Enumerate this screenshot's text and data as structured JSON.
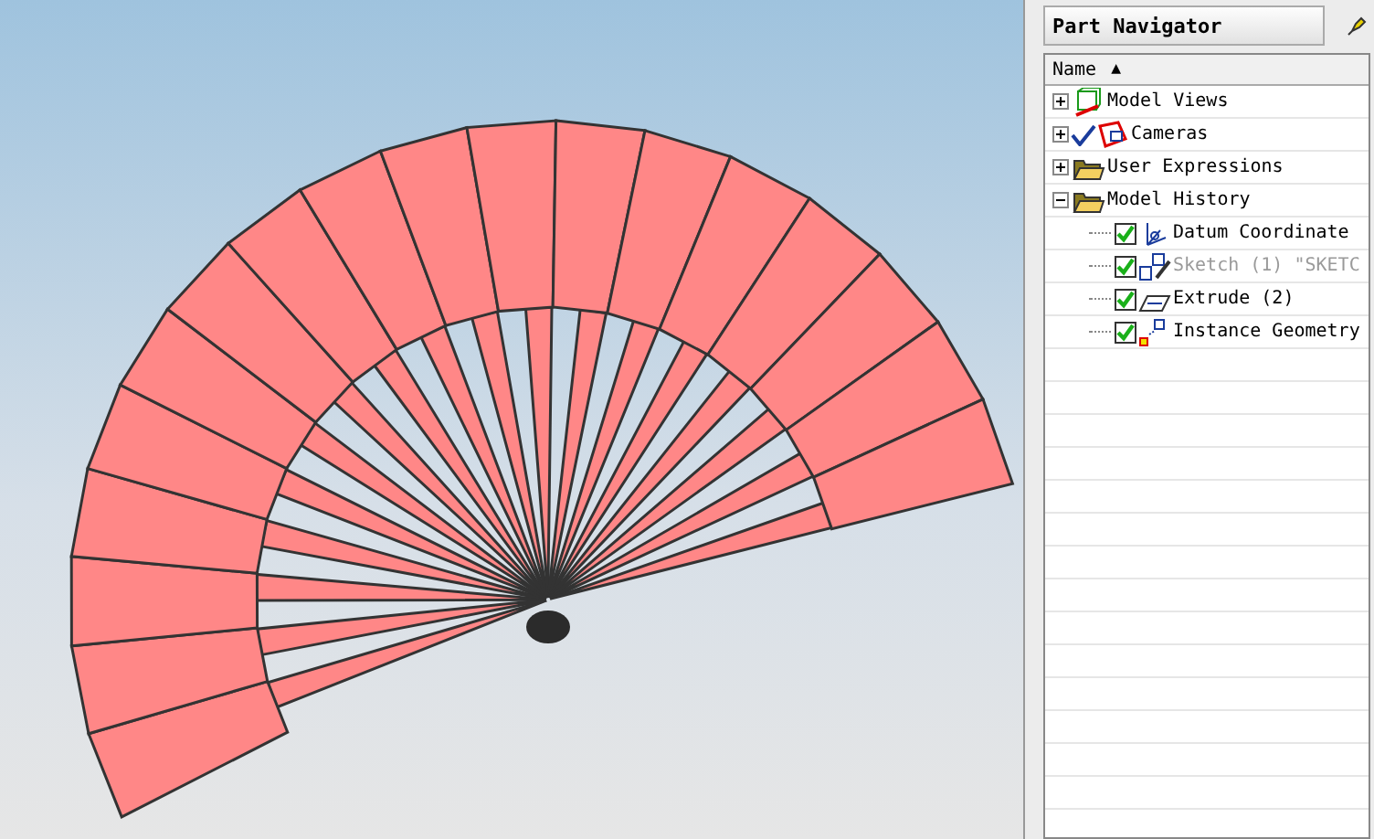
{
  "navigator": {
    "title": "Part Navigator",
    "column": {
      "label": "Name",
      "sort_icon": "▲"
    },
    "tree": [
      {
        "label": "Model Views",
        "expanded": false
      },
      {
        "label": "Cameras",
        "expanded": false,
        "checked": true
      },
      {
        "label": "User Expressions",
        "expanded": false
      },
      {
        "label": "Model History",
        "expanded": true,
        "children": [
          {
            "label": "Datum Coordinate",
            "checked": true,
            "disabled": false
          },
          {
            "label": "Sketch (1) \"SKETC",
            "checked": true,
            "disabled": true
          },
          {
            "label": "Extrude (2)",
            "checked": true,
            "disabled": false
          },
          {
            "label": "Instance Geometry",
            "checked": true,
            "disabled": false
          }
        ]
      }
    ]
  }
}
